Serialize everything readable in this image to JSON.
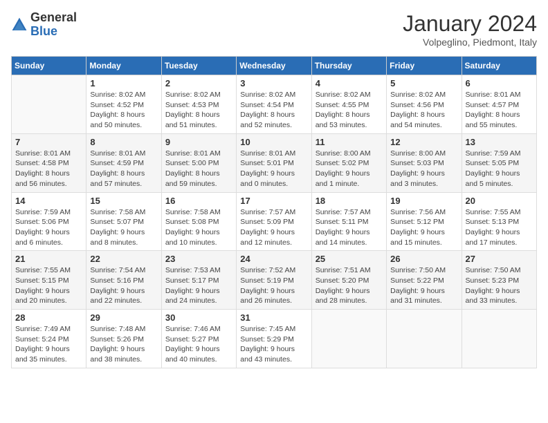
{
  "header": {
    "logo": {
      "general": "General",
      "blue": "Blue"
    },
    "title": "January 2024",
    "location": "Volpeglino, Piedmont, Italy"
  },
  "days_of_week": [
    "Sunday",
    "Monday",
    "Tuesday",
    "Wednesday",
    "Thursday",
    "Friday",
    "Saturday"
  ],
  "weeks": [
    [
      {
        "day": "",
        "sunrise": "",
        "sunset": "",
        "daylight": ""
      },
      {
        "day": "1",
        "sunrise": "Sunrise: 8:02 AM",
        "sunset": "Sunset: 4:52 PM",
        "daylight": "Daylight: 8 hours and 50 minutes."
      },
      {
        "day": "2",
        "sunrise": "Sunrise: 8:02 AM",
        "sunset": "Sunset: 4:53 PM",
        "daylight": "Daylight: 8 hours and 51 minutes."
      },
      {
        "day": "3",
        "sunrise": "Sunrise: 8:02 AM",
        "sunset": "Sunset: 4:54 PM",
        "daylight": "Daylight: 8 hours and 52 minutes."
      },
      {
        "day": "4",
        "sunrise": "Sunrise: 8:02 AM",
        "sunset": "Sunset: 4:55 PM",
        "daylight": "Daylight: 8 hours and 53 minutes."
      },
      {
        "day": "5",
        "sunrise": "Sunrise: 8:02 AM",
        "sunset": "Sunset: 4:56 PM",
        "daylight": "Daylight: 8 hours and 54 minutes."
      },
      {
        "day": "6",
        "sunrise": "Sunrise: 8:01 AM",
        "sunset": "Sunset: 4:57 PM",
        "daylight": "Daylight: 8 hours and 55 minutes."
      }
    ],
    [
      {
        "day": "7",
        "sunrise": "Sunrise: 8:01 AM",
        "sunset": "Sunset: 4:58 PM",
        "daylight": "Daylight: 8 hours and 56 minutes."
      },
      {
        "day": "8",
        "sunrise": "Sunrise: 8:01 AM",
        "sunset": "Sunset: 4:59 PM",
        "daylight": "Daylight: 8 hours and 57 minutes."
      },
      {
        "day": "9",
        "sunrise": "Sunrise: 8:01 AM",
        "sunset": "Sunset: 5:00 PM",
        "daylight": "Daylight: 8 hours and 59 minutes."
      },
      {
        "day": "10",
        "sunrise": "Sunrise: 8:01 AM",
        "sunset": "Sunset: 5:01 PM",
        "daylight": "Daylight: 9 hours and 0 minutes."
      },
      {
        "day": "11",
        "sunrise": "Sunrise: 8:00 AM",
        "sunset": "Sunset: 5:02 PM",
        "daylight": "Daylight: 9 hours and 1 minute."
      },
      {
        "day": "12",
        "sunrise": "Sunrise: 8:00 AM",
        "sunset": "Sunset: 5:03 PM",
        "daylight": "Daylight: 9 hours and 3 minutes."
      },
      {
        "day": "13",
        "sunrise": "Sunrise: 7:59 AM",
        "sunset": "Sunset: 5:05 PM",
        "daylight": "Daylight: 9 hours and 5 minutes."
      }
    ],
    [
      {
        "day": "14",
        "sunrise": "Sunrise: 7:59 AM",
        "sunset": "Sunset: 5:06 PM",
        "daylight": "Daylight: 9 hours and 6 minutes."
      },
      {
        "day": "15",
        "sunrise": "Sunrise: 7:58 AM",
        "sunset": "Sunset: 5:07 PM",
        "daylight": "Daylight: 9 hours and 8 minutes."
      },
      {
        "day": "16",
        "sunrise": "Sunrise: 7:58 AM",
        "sunset": "Sunset: 5:08 PM",
        "daylight": "Daylight: 9 hours and 10 minutes."
      },
      {
        "day": "17",
        "sunrise": "Sunrise: 7:57 AM",
        "sunset": "Sunset: 5:09 PM",
        "daylight": "Daylight: 9 hours and 12 minutes."
      },
      {
        "day": "18",
        "sunrise": "Sunrise: 7:57 AM",
        "sunset": "Sunset: 5:11 PM",
        "daylight": "Daylight: 9 hours and 14 minutes."
      },
      {
        "day": "19",
        "sunrise": "Sunrise: 7:56 AM",
        "sunset": "Sunset: 5:12 PM",
        "daylight": "Daylight: 9 hours and 15 minutes."
      },
      {
        "day": "20",
        "sunrise": "Sunrise: 7:55 AM",
        "sunset": "Sunset: 5:13 PM",
        "daylight": "Daylight: 9 hours and 17 minutes."
      }
    ],
    [
      {
        "day": "21",
        "sunrise": "Sunrise: 7:55 AM",
        "sunset": "Sunset: 5:15 PM",
        "daylight": "Daylight: 9 hours and 20 minutes."
      },
      {
        "day": "22",
        "sunrise": "Sunrise: 7:54 AM",
        "sunset": "Sunset: 5:16 PM",
        "daylight": "Daylight: 9 hours and 22 minutes."
      },
      {
        "day": "23",
        "sunrise": "Sunrise: 7:53 AM",
        "sunset": "Sunset: 5:17 PM",
        "daylight": "Daylight: 9 hours and 24 minutes."
      },
      {
        "day": "24",
        "sunrise": "Sunrise: 7:52 AM",
        "sunset": "Sunset: 5:19 PM",
        "daylight": "Daylight: 9 hours and 26 minutes."
      },
      {
        "day": "25",
        "sunrise": "Sunrise: 7:51 AM",
        "sunset": "Sunset: 5:20 PM",
        "daylight": "Daylight: 9 hours and 28 minutes."
      },
      {
        "day": "26",
        "sunrise": "Sunrise: 7:50 AM",
        "sunset": "Sunset: 5:22 PM",
        "daylight": "Daylight: 9 hours and 31 minutes."
      },
      {
        "day": "27",
        "sunrise": "Sunrise: 7:50 AM",
        "sunset": "Sunset: 5:23 PM",
        "daylight": "Daylight: 9 hours and 33 minutes."
      }
    ],
    [
      {
        "day": "28",
        "sunrise": "Sunrise: 7:49 AM",
        "sunset": "Sunset: 5:24 PM",
        "daylight": "Daylight: 9 hours and 35 minutes."
      },
      {
        "day": "29",
        "sunrise": "Sunrise: 7:48 AM",
        "sunset": "Sunset: 5:26 PM",
        "daylight": "Daylight: 9 hours and 38 minutes."
      },
      {
        "day": "30",
        "sunrise": "Sunrise: 7:46 AM",
        "sunset": "Sunset: 5:27 PM",
        "daylight": "Daylight: 9 hours and 40 minutes."
      },
      {
        "day": "31",
        "sunrise": "Sunrise: 7:45 AM",
        "sunset": "Sunset: 5:29 PM",
        "daylight": "Daylight: 9 hours and 43 minutes."
      },
      {
        "day": "",
        "sunrise": "",
        "sunset": "",
        "daylight": ""
      },
      {
        "day": "",
        "sunrise": "",
        "sunset": "",
        "daylight": ""
      },
      {
        "day": "",
        "sunrise": "",
        "sunset": "",
        "daylight": ""
      }
    ]
  ]
}
